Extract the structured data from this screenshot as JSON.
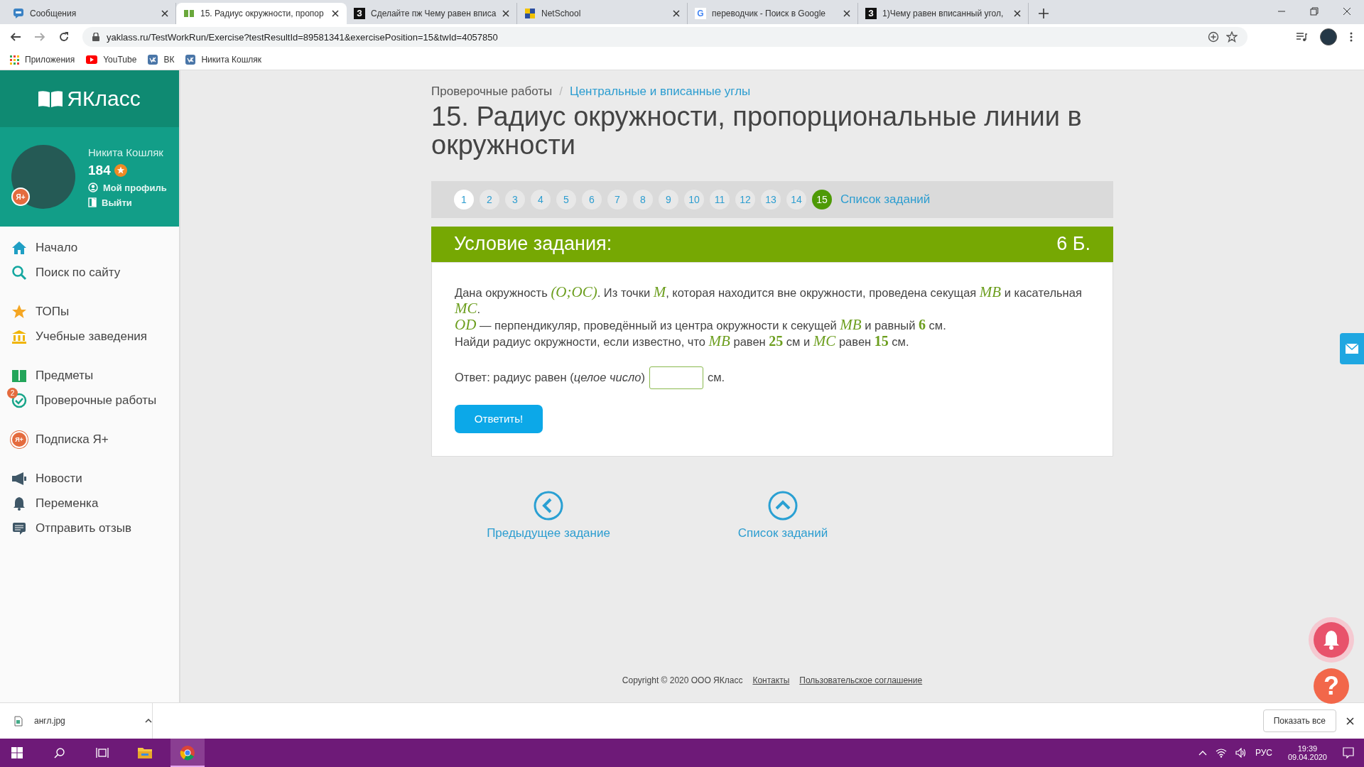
{
  "browser": {
    "tabs": [
      {
        "title": "Сообщения",
        "selected": false
      },
      {
        "title": "15. Радиус окружности, пропор",
        "selected": true
      },
      {
        "title": "Сделайте пж Чему равен вписа",
        "letter": "З",
        "selected": false
      },
      {
        "title": "NetSchool",
        "selected": false
      },
      {
        "title": "переводчик - Поиск в Google",
        "letter": "G",
        "selected": false
      },
      {
        "title": "1)Чему равен вписанный угол,",
        "letter": "З",
        "selected": false
      }
    ],
    "url": "yaklass.ru/TestWorkRun/Exercise?testResultId=89581341&exercisePosition=15&twId=4057850",
    "bookmarks": [
      "Приложения",
      "YouTube",
      "ВК",
      "Никита Кошляк"
    ]
  },
  "sidebar": {
    "logo": "ЯКласс",
    "user": {
      "name": "Никита Кошляк",
      "points": "184",
      "badge": "Я+",
      "links": [
        "Мой профиль",
        "Выйти"
      ]
    },
    "groups": [
      [
        {
          "label": "Начало"
        },
        {
          "label": "Поиск по сайту"
        }
      ],
      [
        {
          "label": "ТОПы"
        },
        {
          "label": "Учебные заведения"
        }
      ],
      [
        {
          "label": "Предметы"
        },
        {
          "label": "Проверочные работы",
          "count": "2"
        }
      ],
      [
        {
          "label": "Подписка Я+",
          "badge": "Я+"
        }
      ],
      [
        {
          "label": "Новости"
        },
        {
          "label": "Переменка"
        },
        {
          "label": "Отправить отзыв"
        }
      ]
    ]
  },
  "breadcrumb": [
    "Проверочные работы",
    "Центральные и вписанные углы"
  ],
  "breadcrumb_separator": "/",
  "title": "15. Радиус окружности, пропорциональные линии в окружности",
  "pager": {
    "pages": [
      {
        "label": "1",
        "selected": false,
        "visited": true
      },
      {
        "label": "2",
        "selected": false,
        "visited": false
      },
      {
        "label": "3",
        "selected": false,
        "visited": false
      },
      {
        "label": "4",
        "selected": false,
        "visited": false
      },
      {
        "label": "5",
        "selected": false,
        "visited": false
      },
      {
        "label": "6",
        "selected": false,
        "visited": false
      },
      {
        "label": "7",
        "selected": false,
        "visited": false
      },
      {
        "label": "8",
        "selected": false,
        "visited": false
      },
      {
        "label": "9",
        "selected": false,
        "visited": false
      },
      {
        "label": "10",
        "selected": false,
        "visited": false
      },
      {
        "label": "11",
        "selected": false,
        "visited": false
      },
      {
        "label": "12",
        "selected": false,
        "visited": false
      },
      {
        "label": "13",
        "selected": false,
        "visited": false
      },
      {
        "label": "14",
        "selected": false,
        "visited": false
      },
      {
        "label": "15",
        "selected": true,
        "visited": false
      }
    ],
    "list_link": "Список заданий"
  },
  "task": {
    "header": "Условие задания:",
    "score": "6 Б.",
    "lines": [
      [
        {
          "kind": "text",
          "t": "Дана окружность "
        },
        {
          "kind": "math",
          "t": "(O;OC)"
        },
        {
          "kind": "text",
          "t": ". Из точки "
        },
        {
          "kind": "math",
          "t": "M"
        },
        {
          "kind": "text",
          "t": ", которая находится вне окружности, проведена секущая "
        },
        {
          "kind": "math",
          "t": "MB"
        },
        {
          "kind": "text",
          "t": " и касательная "
        },
        {
          "kind": "math",
          "t": "MC"
        },
        {
          "kind": "text",
          "t": "."
        }
      ],
      [
        {
          "kind": "math",
          "t": "OD"
        },
        {
          "kind": "text",
          "t": " — перпендикуляр, проведённый из центра окружности к секущей "
        },
        {
          "kind": "math",
          "t": "MB"
        },
        {
          "kind": "text",
          "t": " и равный "
        },
        {
          "kind": "num",
          "t": "6"
        },
        {
          "kind": "text",
          "t": " см."
        }
      ],
      [
        {
          "kind": "text",
          "t": "Найди радиус окружности, если известно, что "
        },
        {
          "kind": "math",
          "t": "MB"
        },
        {
          "kind": "text",
          "t": " равен "
        },
        {
          "kind": "num",
          "t": "25"
        },
        {
          "kind": "text",
          "t": " см и "
        },
        {
          "kind": "math",
          "t": "MC"
        },
        {
          "kind": "text",
          "t": " равен "
        },
        {
          "kind": "num",
          "t": "15"
        },
        {
          "kind": "text",
          "t": " см."
        }
      ]
    ],
    "answer_label": "Ответ: радиус равен (*целое число*)",
    "answer_unit": "см.",
    "submit": "Ответить!"
  },
  "nav": [
    "Предыдущее задание",
    "Список заданий"
  ],
  "footer": {
    "copyright": "Copyright © 2020 ООО ЯКласс",
    "links": [
      "Контакты",
      "Пользовательское соглашение"
    ]
  },
  "floating": {
    "help": "?"
  },
  "download": {
    "file": "англ.jpg",
    "show_all": "Показать все"
  },
  "taskbar": {
    "apps": [
      {
        "selected": false
      },
      {
        "selected": false
      },
      {
        "selected": false
      },
      {
        "selected": true
      }
    ],
    "lang": "РУС",
    "time": "19:39",
    "date": "09.04.2020"
  }
}
